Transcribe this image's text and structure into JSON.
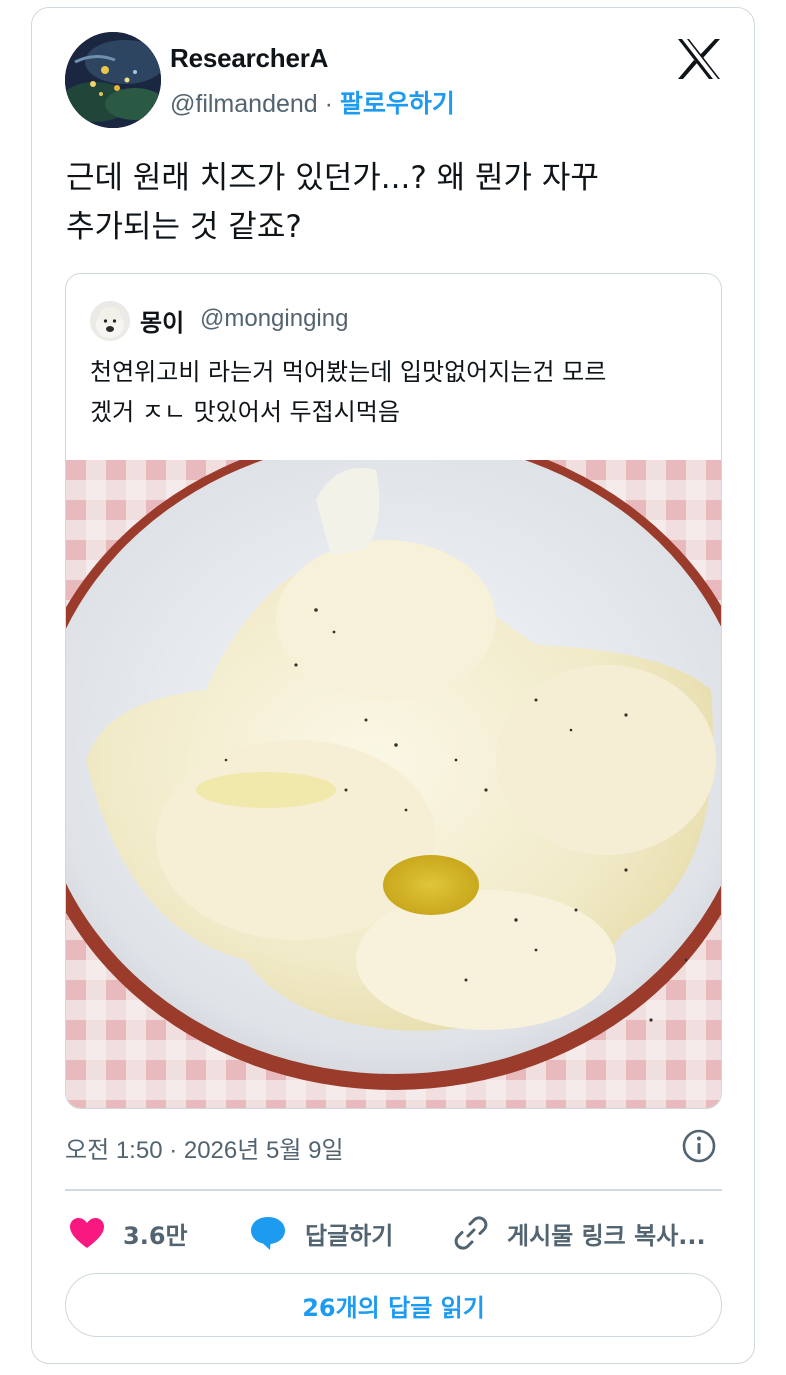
{
  "author": {
    "name": "ResearcherA",
    "handle": "@filmandend",
    "separator": "·",
    "follow_label": "팔로우하기"
  },
  "tweet": {
    "text_line1": "근데 원래 치즈가 있던가...? 왜 뭔가 자꾸",
    "text_line2": "추가되는 것 같죠?"
  },
  "quote": {
    "name": "몽이",
    "handle": "@monginging",
    "text_line1": "천연위고비 라는거 먹어봤는데 입맛없어지는건 모르",
    "text_line2": "겠거 ㅈㄴ 맛있어서 두접시먹음"
  },
  "meta": {
    "timestamp": "오전 1:50 · 2026년 5월 9일"
  },
  "actions": {
    "likes_count": "3.6만",
    "reply_label": "답글하기",
    "copy_link_label": "게시물 링크 복사..."
  },
  "read_replies_label": "26개의 답글 읽기",
  "colors": {
    "accent": "#1d9bf0",
    "like": "#f91880",
    "text_secondary": "#536471",
    "border": "#cfd9de"
  },
  "icons": [
    "x-logo-icon",
    "info-icon",
    "heart-icon",
    "reply-bubble-icon",
    "link-icon"
  ]
}
